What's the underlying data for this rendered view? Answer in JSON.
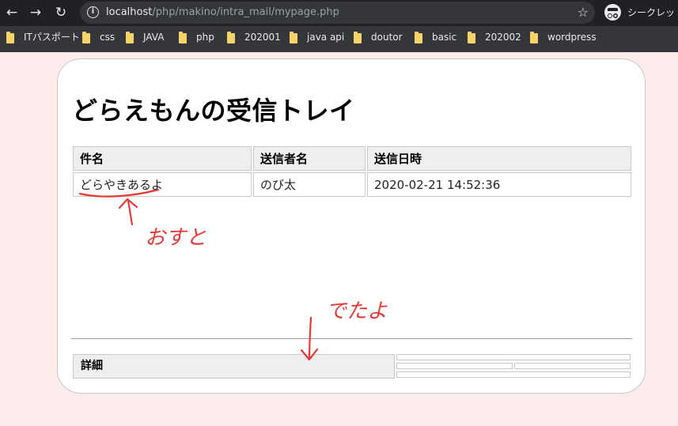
{
  "browser": {
    "url_host": "localhost",
    "url_path": "/php/makino/intra_mail/mypage.php",
    "incognito_label": "シークレット",
    "icons": {
      "back": "back-arrow-icon",
      "forward": "forward-arrow-icon",
      "reload": "reload-icon",
      "info": "info-icon",
      "star": "star-icon",
      "incognito": "incognito-icon",
      "folder": "folder-icon"
    }
  },
  "bookmarks": [
    {
      "label": "ITパスポート"
    },
    {
      "label": "css"
    },
    {
      "label": "JAVA"
    },
    {
      "label": "php"
    },
    {
      "label": "202001"
    },
    {
      "label": "java api"
    },
    {
      "label": "doutor"
    },
    {
      "label": "basic"
    },
    {
      "label": "202002"
    },
    {
      "label": "wordpress"
    }
  ],
  "page": {
    "title": "どらえもんの受信トレイ",
    "table": {
      "headers": [
        "件名",
        "送信者名",
        "送信日時"
      ],
      "rows": [
        {
          "subject": "どらやきあるよ",
          "sender": "のび太",
          "datetime": "2020-02-21 14:52:36"
        }
      ]
    },
    "detail_label": "詳細"
  },
  "annotations": {
    "push_note": "おすと",
    "appear_note": "でたよ",
    "color": "#e53935"
  }
}
